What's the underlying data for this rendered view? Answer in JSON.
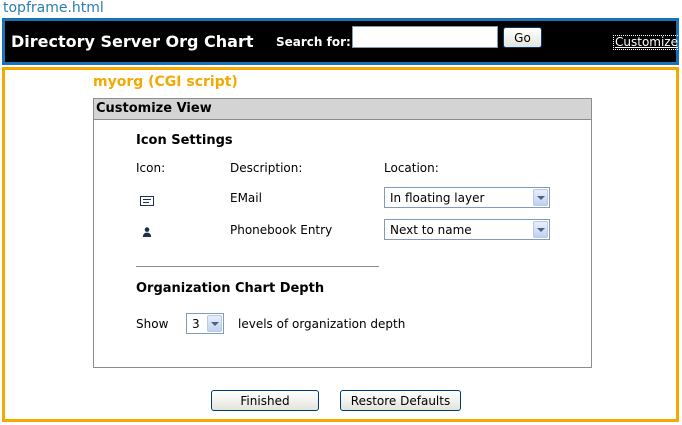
{
  "topframe": {
    "frame_label": "topframe.html",
    "app_title": "Directory Server Org Chart",
    "search_label": "Search for:",
    "search_value": "",
    "go_label": "Go",
    "customize_label": "Customize"
  },
  "mainframe": {
    "frame_label": "myorg (CGI script)",
    "panel_title": "Customize View",
    "icon_settings": {
      "title": "Icon Settings",
      "col_icon": "Icon:",
      "col_description": "Description:",
      "col_location": "Location:",
      "rows": [
        {
          "icon": "email-icon",
          "description": "EMail",
          "location": "In floating layer"
        },
        {
          "icon": "phonebook-icon",
          "description": "Phonebook Entry",
          "location": "Next to name"
        }
      ]
    },
    "depth": {
      "title": "Organization Chart Depth",
      "show_label": "Show",
      "value": "3",
      "suffix": "levels of organization depth"
    },
    "finished_label": "Finished",
    "restore_label": "Restore Defaults"
  },
  "colors": {
    "topframe_border": "#1a73b8",
    "mainframe_border": "#f5a800",
    "topbar_bg": "#000000",
    "panel_header_bg": "#d4d4d4"
  }
}
